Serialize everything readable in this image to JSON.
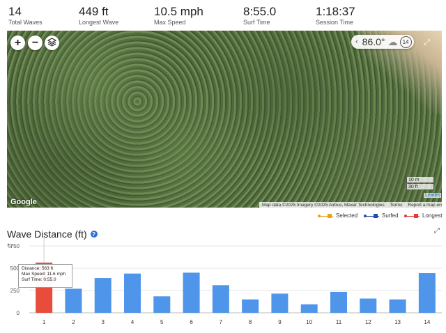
{
  "stats": [
    {
      "value": "14",
      "label": "Total Waves"
    },
    {
      "value": "449 ft",
      "label": "Longest Wave"
    },
    {
      "value": "10.5 mph",
      "label": "Max Speed"
    },
    {
      "value": "8:55.0",
      "label": "Surf Time"
    },
    {
      "value": "1:18:37",
      "label": "Session Time"
    }
  ],
  "map": {
    "zoom_in": "+",
    "zoom_out": "−",
    "weather_temp": "86.0°",
    "wind_value": "14",
    "scale_meters": "10 m",
    "scale_feet": "30 ft",
    "leaflet": "Leaflet",
    "google": "Google",
    "attribution": {
      "map_data": "Map data ©2025 Imagery ©2025 Airbus, Maxar Technologies",
      "terms": "Terms",
      "report": "Report a map error"
    }
  },
  "legend": [
    {
      "label": "Selected",
      "color": "#e8a21a"
    },
    {
      "label": "Surfed",
      "color": "#1e4fa8"
    },
    {
      "label": "Longest",
      "color": "#e53935"
    }
  ],
  "chart_title": "Wave Distance (ft)",
  "help_icon": "?",
  "tooltip": {
    "line1": "Distance: 563 ft",
    "line2": "Max Speed: 11.6 mph",
    "line3": "Surf Time: 0:55.0"
  },
  "chart_data": {
    "type": "bar",
    "categories": [
      "1",
      "2",
      "3",
      "4",
      "5",
      "6",
      "7",
      "8",
      "9",
      "10",
      "11",
      "12",
      "13",
      "14"
    ],
    "values": [
      563,
      270,
      390,
      440,
      185,
      450,
      310,
      150,
      215,
      95,
      235,
      160,
      150,
      445
    ],
    "highlight_index": 0,
    "bar_color": "#4f95ea",
    "highlight_color": "#e74c3c",
    "yticks": [
      "0",
      "250",
      "500",
      "750"
    ],
    "ylim": [
      0,
      750
    ],
    "xlabel": "",
    "ylabel": ""
  }
}
